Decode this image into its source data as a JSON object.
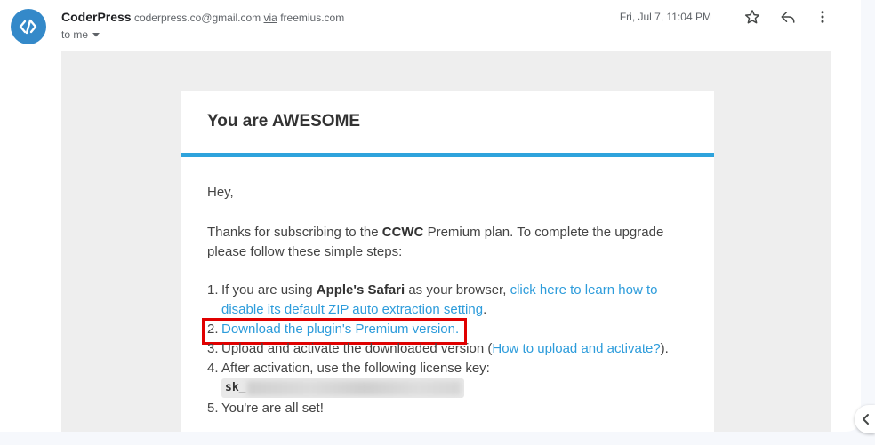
{
  "colors": {
    "accent": "#2ea3dc",
    "link": "#2d9cdb",
    "highlight": "#e00000",
    "avatar": "#3489c9"
  },
  "email": {
    "sender_name": "CoderPress",
    "sender_email": "coderpress.co@gmail.com",
    "via_label": "via",
    "via_domain": "freemius.com",
    "recipient": "to me",
    "date": "Fri, Jul 7, 11:04 PM",
    "icons": [
      "avatar-logo-icon",
      "star-icon",
      "reply-icon",
      "more-vert-icon",
      "caret-down-icon",
      "chevron-left-icon"
    ]
  },
  "card": {
    "title": "You are AWESOME",
    "greeting": "Hey,",
    "intro": {
      "before": "Thanks for subscribing to the ",
      "plan": "CCWC",
      "after": " Premium plan. To complete the upgrade please follow these simple steps:"
    },
    "steps": [
      {
        "number": "1.",
        "before": "If you are using ",
        "bold": "Apple's Safari",
        "middle": " as your browser, ",
        "link": "click here to learn how to disable its default ZIP auto extraction setting",
        "after": "."
      },
      {
        "number": "2.",
        "link": "Download the plugin's Premium version."
      },
      {
        "number": "3.",
        "before": "Upload and activate the downloaded version (",
        "link": "How to upload and activate?",
        "after": ")."
      },
      {
        "number": "4.",
        "text": "After activation, use the following license key:",
        "license_prefix": "sk_"
      },
      {
        "number": "5.",
        "text": "You're are all set!"
      }
    ]
  }
}
